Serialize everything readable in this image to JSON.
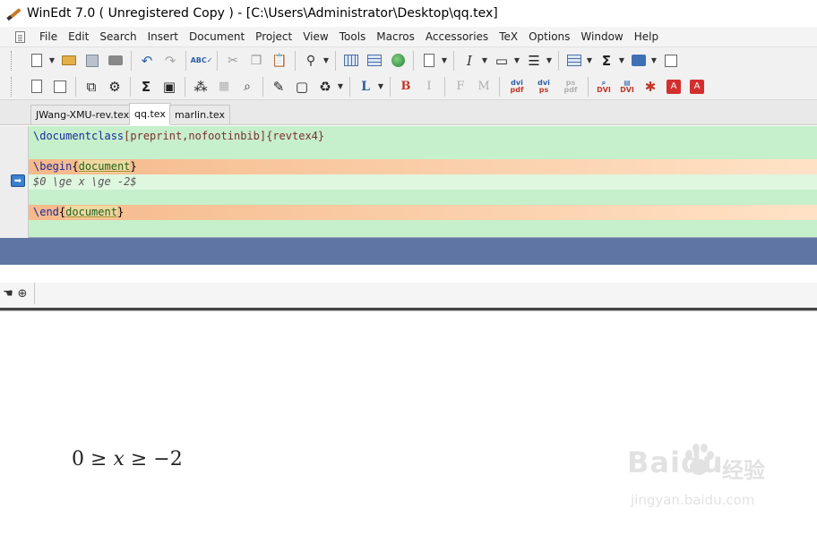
{
  "window": {
    "title": "WinEdt 7.0  ( Unregistered  Copy )  - [C:\\Users\\Administrator\\Desktop\\qq.tex]"
  },
  "menu": {
    "items": [
      "File",
      "Edit",
      "Search",
      "Insert",
      "Document",
      "Project",
      "View",
      "Tools",
      "Macros",
      "Accessories",
      "TeX",
      "Options",
      "Window",
      "Help"
    ]
  },
  "toolbar": {
    "bold_label": "B",
    "italic_label": "I",
    "font_f_label": "F",
    "font_m_label": "M",
    "l_label": "L",
    "sigma_label": "Σ",
    "dvi_pdf_label": [
      "dvi",
      "pdf"
    ],
    "dvi_ps_label": [
      "dvi",
      "ps"
    ],
    "ps_pdf_label": [
      "ps",
      "pdf"
    ],
    "dvi_label": "DVI"
  },
  "tabs": [
    {
      "label": "JWang-XMU-rev.tex",
      "active": false
    },
    {
      "label": "qq.tex",
      "active": true
    },
    {
      "label": "marlin.tex",
      "active": false
    }
  ],
  "editor": {
    "line1": {
      "cmd": "\\documentclass",
      "opt": "[preprint,nofootinbib]",
      "arg": "{revtex4}"
    },
    "line3": {
      "cmd": "\\begin",
      "env": "document"
    },
    "line4": {
      "text": "$0 \\ge x \\ge -2$"
    },
    "line6": {
      "cmd": "\\end",
      "env": "document"
    }
  },
  "preview": {
    "formula": [
      "0",
      "≥",
      "x",
      "≥",
      "−2"
    ]
  },
  "watermark": {
    "logo": "Baidu",
    "cn": "经验",
    "url": "jingyan.baidu.com"
  },
  "colors": {
    "editor_bg": "#c6efcb",
    "env_highlight": "#f5b98a",
    "band": "#5f76a4"
  }
}
